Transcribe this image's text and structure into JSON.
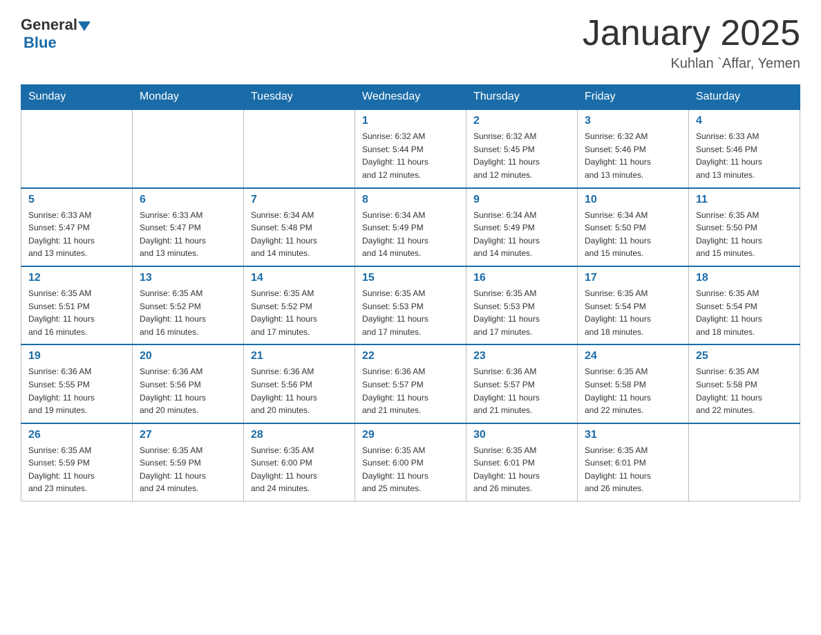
{
  "header": {
    "logo": {
      "general": "General",
      "blue": "Blue"
    },
    "title": "January 2025",
    "subtitle": "Kuhlan `Affar, Yemen"
  },
  "calendar": {
    "days_of_week": [
      "Sunday",
      "Monday",
      "Tuesday",
      "Wednesday",
      "Thursday",
      "Friday",
      "Saturday"
    ],
    "weeks": [
      [
        {
          "day": "",
          "info": ""
        },
        {
          "day": "",
          "info": ""
        },
        {
          "day": "",
          "info": ""
        },
        {
          "day": "1",
          "info": "Sunrise: 6:32 AM\nSunset: 5:44 PM\nDaylight: 11 hours\nand 12 minutes."
        },
        {
          "day": "2",
          "info": "Sunrise: 6:32 AM\nSunset: 5:45 PM\nDaylight: 11 hours\nand 12 minutes."
        },
        {
          "day": "3",
          "info": "Sunrise: 6:32 AM\nSunset: 5:46 PM\nDaylight: 11 hours\nand 13 minutes."
        },
        {
          "day": "4",
          "info": "Sunrise: 6:33 AM\nSunset: 5:46 PM\nDaylight: 11 hours\nand 13 minutes."
        }
      ],
      [
        {
          "day": "5",
          "info": "Sunrise: 6:33 AM\nSunset: 5:47 PM\nDaylight: 11 hours\nand 13 minutes."
        },
        {
          "day": "6",
          "info": "Sunrise: 6:33 AM\nSunset: 5:47 PM\nDaylight: 11 hours\nand 13 minutes."
        },
        {
          "day": "7",
          "info": "Sunrise: 6:34 AM\nSunset: 5:48 PM\nDaylight: 11 hours\nand 14 minutes."
        },
        {
          "day": "8",
          "info": "Sunrise: 6:34 AM\nSunset: 5:49 PM\nDaylight: 11 hours\nand 14 minutes."
        },
        {
          "day": "9",
          "info": "Sunrise: 6:34 AM\nSunset: 5:49 PM\nDaylight: 11 hours\nand 14 minutes."
        },
        {
          "day": "10",
          "info": "Sunrise: 6:34 AM\nSunset: 5:50 PM\nDaylight: 11 hours\nand 15 minutes."
        },
        {
          "day": "11",
          "info": "Sunrise: 6:35 AM\nSunset: 5:50 PM\nDaylight: 11 hours\nand 15 minutes."
        }
      ],
      [
        {
          "day": "12",
          "info": "Sunrise: 6:35 AM\nSunset: 5:51 PM\nDaylight: 11 hours\nand 16 minutes."
        },
        {
          "day": "13",
          "info": "Sunrise: 6:35 AM\nSunset: 5:52 PM\nDaylight: 11 hours\nand 16 minutes."
        },
        {
          "day": "14",
          "info": "Sunrise: 6:35 AM\nSunset: 5:52 PM\nDaylight: 11 hours\nand 17 minutes."
        },
        {
          "day": "15",
          "info": "Sunrise: 6:35 AM\nSunset: 5:53 PM\nDaylight: 11 hours\nand 17 minutes."
        },
        {
          "day": "16",
          "info": "Sunrise: 6:35 AM\nSunset: 5:53 PM\nDaylight: 11 hours\nand 17 minutes."
        },
        {
          "day": "17",
          "info": "Sunrise: 6:35 AM\nSunset: 5:54 PM\nDaylight: 11 hours\nand 18 minutes."
        },
        {
          "day": "18",
          "info": "Sunrise: 6:35 AM\nSunset: 5:54 PM\nDaylight: 11 hours\nand 18 minutes."
        }
      ],
      [
        {
          "day": "19",
          "info": "Sunrise: 6:36 AM\nSunset: 5:55 PM\nDaylight: 11 hours\nand 19 minutes."
        },
        {
          "day": "20",
          "info": "Sunrise: 6:36 AM\nSunset: 5:56 PM\nDaylight: 11 hours\nand 20 minutes."
        },
        {
          "day": "21",
          "info": "Sunrise: 6:36 AM\nSunset: 5:56 PM\nDaylight: 11 hours\nand 20 minutes."
        },
        {
          "day": "22",
          "info": "Sunrise: 6:36 AM\nSunset: 5:57 PM\nDaylight: 11 hours\nand 21 minutes."
        },
        {
          "day": "23",
          "info": "Sunrise: 6:36 AM\nSunset: 5:57 PM\nDaylight: 11 hours\nand 21 minutes."
        },
        {
          "day": "24",
          "info": "Sunrise: 6:35 AM\nSunset: 5:58 PM\nDaylight: 11 hours\nand 22 minutes."
        },
        {
          "day": "25",
          "info": "Sunrise: 6:35 AM\nSunset: 5:58 PM\nDaylight: 11 hours\nand 22 minutes."
        }
      ],
      [
        {
          "day": "26",
          "info": "Sunrise: 6:35 AM\nSunset: 5:59 PM\nDaylight: 11 hours\nand 23 minutes."
        },
        {
          "day": "27",
          "info": "Sunrise: 6:35 AM\nSunset: 5:59 PM\nDaylight: 11 hours\nand 24 minutes."
        },
        {
          "day": "28",
          "info": "Sunrise: 6:35 AM\nSunset: 6:00 PM\nDaylight: 11 hours\nand 24 minutes."
        },
        {
          "day": "29",
          "info": "Sunrise: 6:35 AM\nSunset: 6:00 PM\nDaylight: 11 hours\nand 25 minutes."
        },
        {
          "day": "30",
          "info": "Sunrise: 6:35 AM\nSunset: 6:01 PM\nDaylight: 11 hours\nand 26 minutes."
        },
        {
          "day": "31",
          "info": "Sunrise: 6:35 AM\nSunset: 6:01 PM\nDaylight: 11 hours\nand 26 minutes."
        },
        {
          "day": "",
          "info": ""
        }
      ]
    ]
  }
}
